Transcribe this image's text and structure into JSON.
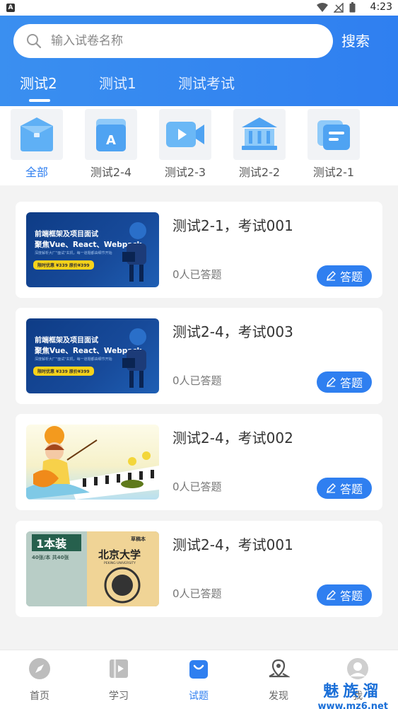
{
  "status_bar": {
    "time": "4:23",
    "app_badge": "A"
  },
  "search": {
    "placeholder": "输入试卷名称",
    "value": "",
    "button_label": "搜索"
  },
  "tabs": [
    {
      "label": "测试2",
      "active": true
    },
    {
      "label": "测试1",
      "active": false
    },
    {
      "label": "测试考试",
      "active": false
    }
  ],
  "categories": [
    {
      "label": "全部",
      "icon": "briefcase-icon",
      "active": true
    },
    {
      "label": "测试2-4",
      "icon": "letter-a-icon",
      "active": false
    },
    {
      "label": "测试2-3",
      "icon": "video-camera-icon",
      "active": false
    },
    {
      "label": "测试2-2",
      "icon": "institution-icon",
      "active": false
    },
    {
      "label": "测试2-1",
      "icon": "document-stack-icon",
      "active": false
    }
  ],
  "exams": [
    {
      "title": "测试2-1，考试001",
      "count": "0人已答题",
      "button": "答题",
      "thumb": "course-banner"
    },
    {
      "title": "测试2-4，考试003",
      "count": "0人已答题",
      "button": "答题",
      "thumb": "course-banner"
    },
    {
      "title": "测试2-4，考试002",
      "count": "0人已答题",
      "button": "答题",
      "thumb": "cartoon-girl-piano"
    },
    {
      "title": "测试2-4，考试001",
      "count": "0人已答题",
      "button": "答题",
      "thumb": "peking-university-notebook"
    }
  ],
  "course_banner": {
    "line1": "前端框架及项目面试",
    "line2": "聚焦Vue、React、Webpack",
    "line3": "深度解析大厂\"面试\"玄机，每一道题都由细节开始",
    "price": "限时优惠 ¥339 原价¥399"
  },
  "notebook": {
    "tag": "1本装",
    "spec": "40张/本 共40张",
    "brand": "草稿本",
    "name_cn": "北京大学",
    "name_en": "PEKING UNIVERSITY"
  },
  "tabbar": [
    {
      "label": "首页",
      "icon": "compass-icon",
      "active": false
    },
    {
      "label": "学习",
      "icon": "book-play-icon",
      "active": false
    },
    {
      "label": "试题",
      "icon": "shopping-bag-icon",
      "active": true
    },
    {
      "label": "发现",
      "icon": "map-pin-icon",
      "active": false
    },
    {
      "label": "我",
      "icon": "user-avatar-icon",
      "active": false
    }
  ],
  "watermark": {
    "main": "魅族溜",
    "url": "www.mz6.net"
  },
  "colors": {
    "primary": "#2f7ff0",
    "header_gradient_start": "#3a8ff0",
    "background": "#f3f3f3"
  }
}
